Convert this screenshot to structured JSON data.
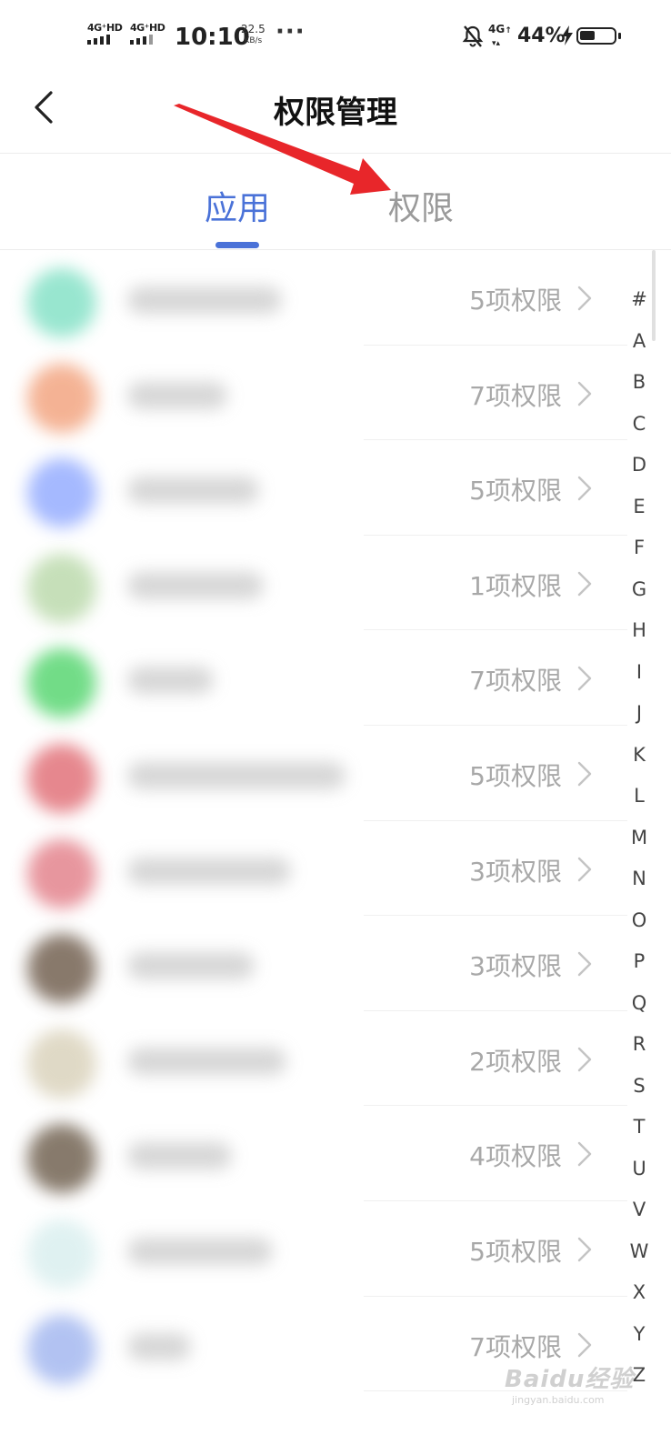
{
  "status_bar": {
    "sim1": "4G⁺HD",
    "sim2": "4G⁺HD",
    "time": "10:10",
    "speed_value": "22.5",
    "speed_unit": "KB/s",
    "more": "···",
    "data_net": "4G",
    "battery_pct": "44%",
    "battery_level": 0.44
  },
  "header": {
    "title": "权限管理",
    "back_icon": "chevron-left-icon"
  },
  "tabs": [
    {
      "label": "应用",
      "active": true
    },
    {
      "label": "权限",
      "active": false
    }
  ],
  "colors": {
    "accent": "#4a72d8",
    "tab_inactive": "#9a9a9a",
    "annotation_arrow": "#e8262a",
    "perm_text": "#a8a8a8"
  },
  "apps": [
    {
      "perm": "5项权限",
      "icon_color": "#7fe0c4"
    },
    {
      "perm": "7项权限",
      "icon_color": "#f2a07a"
    },
    {
      "perm": "5项权限",
      "icon_color": "#8fa8ff"
    },
    {
      "perm": "1项权限",
      "icon_color": "#b8d8a8"
    },
    {
      "perm": "7项权限",
      "icon_color": "#4fd46a"
    },
    {
      "perm": "5项权限",
      "icon_color": "#e06a72"
    },
    {
      "perm": "3项权限",
      "icon_color": "#e27c86"
    },
    {
      "perm": "3项权限",
      "icon_color": "#6b5847"
    },
    {
      "perm": "2项权限",
      "icon_color": "#d8d0b8"
    },
    {
      "perm": "4项权限",
      "icon_color": "#6a5a48"
    },
    {
      "perm": "5项权限",
      "icon_color": "#d8eeee"
    },
    {
      "perm": "7项权限",
      "icon_color": "#9fb4ef"
    }
  ],
  "alphabet": [
    "#",
    "A",
    "B",
    "C",
    "D",
    "E",
    "F",
    "G",
    "H",
    "I",
    "J",
    "K",
    "L",
    "M",
    "N",
    "O",
    "P",
    "Q",
    "R",
    "S",
    "T",
    "U",
    "V",
    "W",
    "X",
    "Y",
    "Z"
  ],
  "watermark": {
    "text": "Baidu经验",
    "sub": "jingyan.baidu.com"
  }
}
